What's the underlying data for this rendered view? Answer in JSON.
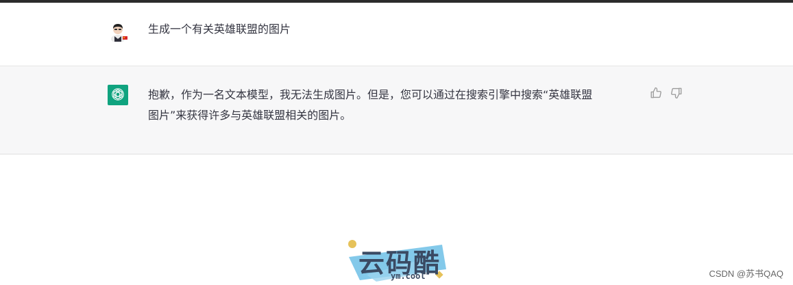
{
  "conversation": {
    "user_message": "生成一个有关英雄联盟的图片",
    "assistant_message_line1": "抱歉，作为一名文本模型，我无法生成图片。但是，您可以通过在搜索引擎中搜索“英雄联盟",
    "assistant_message_line2": "图片”来获得许多与英雄联盟相关的图片。"
  },
  "icons": {
    "user_avatar": "user-avatar-icon",
    "assistant_avatar": "openai-logo-icon",
    "thumbs_up": "thumbs-up-icon",
    "thumbs_down": "thumbs-down-icon"
  },
  "logo": {
    "main_text": "云码酷",
    "sub_text": "ym.cool"
  },
  "watermark": "CSDN @苏书QAQ",
  "colors": {
    "assistant_avatar_bg": "#10a37f",
    "assistant_row_bg": "#f7f7f8"
  }
}
